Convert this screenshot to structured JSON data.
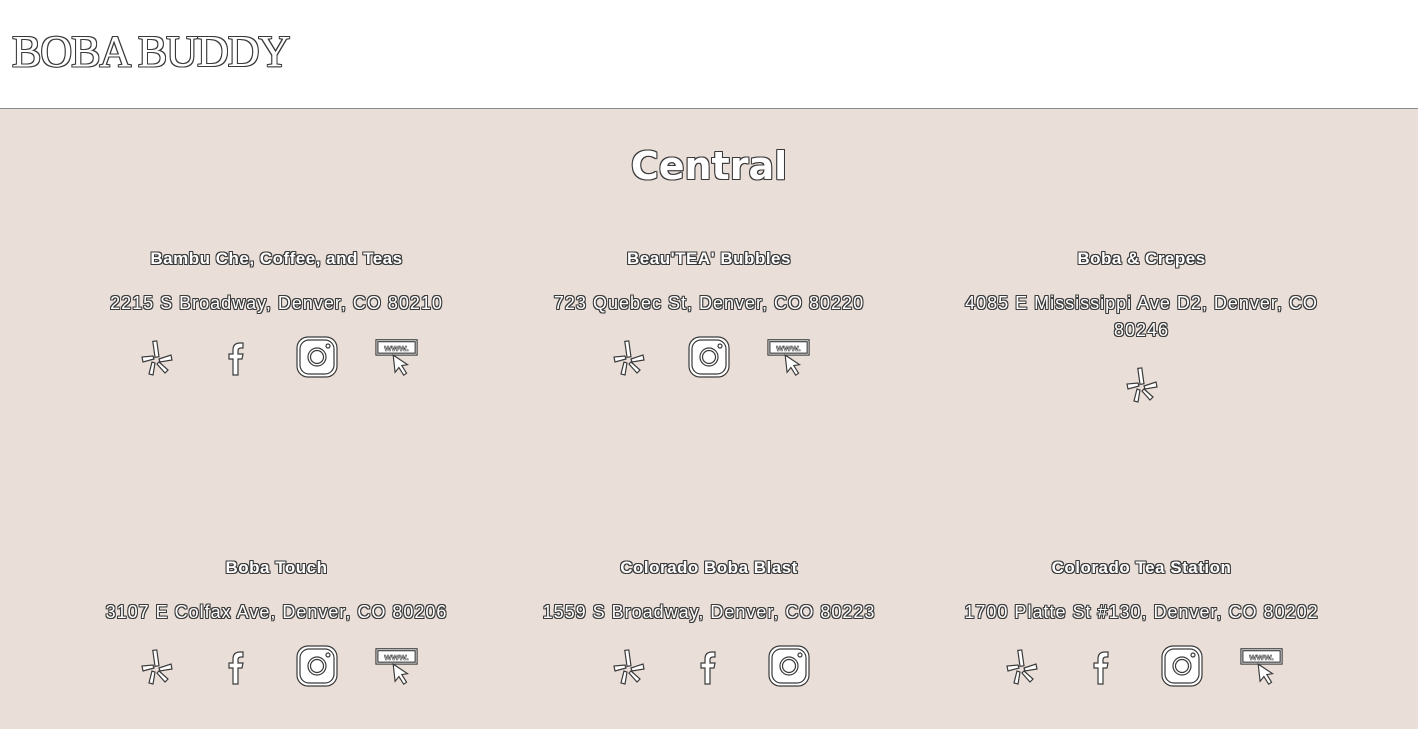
{
  "header": {
    "brand": "BOBA BUDDY"
  },
  "region": {
    "title": "Central"
  },
  "shops": [
    {
      "name": "Bambu Che, Coffee, and Teas",
      "address": "2215 S Broadway, Denver, CO 80210",
      "icons": [
        "yelp-icon",
        "facebook-icon",
        "instagram-icon",
        "website-icon"
      ]
    },
    {
      "name": "Beau'TEA' Bubbles",
      "address": "723 Quebec St, Denver, CO 80220",
      "icons": [
        "yelp-icon",
        "instagram-icon",
        "website-icon"
      ]
    },
    {
      "name": "Boba & Crepes",
      "address": "4085 E Mississippi Ave D2, Denver, CO 80246",
      "icons": [
        "yelp-icon"
      ]
    },
    {
      "name": "Boba Touch",
      "address": "3107 E Colfax Ave, Denver, CO 80206",
      "icons": [
        "yelp-icon",
        "facebook-icon",
        "instagram-icon",
        "website-icon"
      ]
    },
    {
      "name": "Colorado Boba Blast",
      "address": "1559 S Broadway, Denver, CO 80223",
      "icons": [
        "yelp-icon",
        "facebook-icon",
        "instagram-icon"
      ]
    },
    {
      "name": "Colorado Tea Station",
      "address": "1700 Platte St #130, Denver, CO 80202",
      "icons": [
        "yelp-icon",
        "facebook-icon",
        "instagram-icon",
        "website-icon"
      ]
    }
  ],
  "colors": {
    "background": "#eadfd8",
    "header": "#ffffff",
    "outline": "#3a3a3a"
  },
  "icon_labels": {
    "website": "www."
  }
}
